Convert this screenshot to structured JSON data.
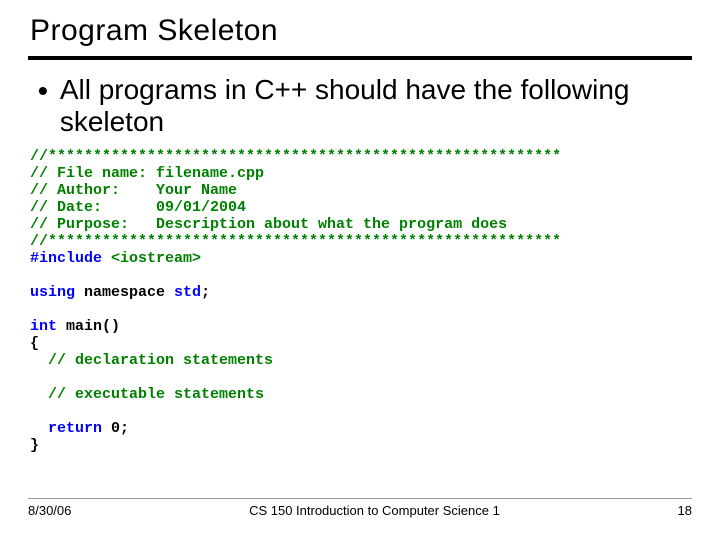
{
  "title": "Program Skeleton",
  "bullet": "All programs in C++ should have the following skeleton",
  "code": {
    "c1": "//*********************************************************",
    "c2": "// File name: filename.cpp",
    "c3": "// Author:    Your Name",
    "c4": "// Date:      09/01/2004",
    "c5": "// Purpose:   Description about what the program does",
    "c6": "//*********************************************************",
    "inc_a": "#include ",
    "inc_b": "<iostream>",
    "using_a": "using",
    "using_b": " namespace ",
    "using_c": "std",
    "using_d": ";",
    "int_kw": "int",
    "main_sig": " main()",
    "brace_open": "{",
    "decl": "  // declaration statements",
    "exec": "  // executable statements",
    "ret_a": "  return",
    "ret_b": " 0;",
    "brace_close": "}"
  },
  "footer": {
    "date": "8/30/06",
    "course": "CS 150 Introduction to Computer Science 1",
    "page": "18"
  }
}
